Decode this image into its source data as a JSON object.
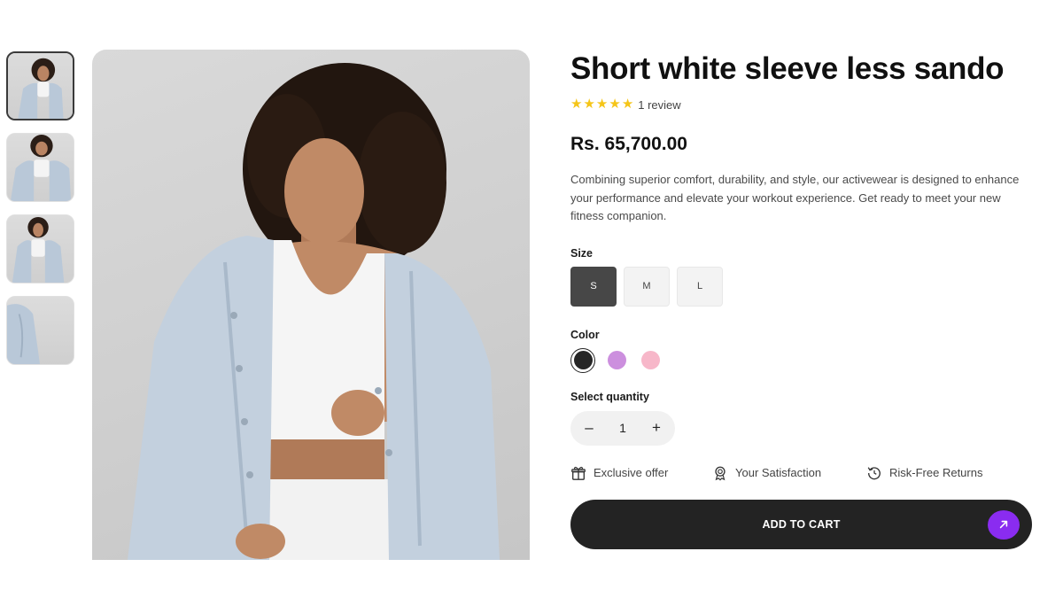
{
  "product": {
    "title": "Short white sleeve less sando",
    "rating": {
      "stars": 5,
      "max": 5,
      "review_text": "1 review"
    },
    "price": "Rs. 65,700.00",
    "description": "Combining superior comfort, durability, and style, our activewear is designed to enhance your performance and elevate your workout experience. Get ready to meet your new fitness companion."
  },
  "gallery": {
    "thumbnails": [
      "thumb-1",
      "thumb-2",
      "thumb-3",
      "thumb-4"
    ],
    "active_index": 0
  },
  "size": {
    "label": "Size",
    "options": [
      "S",
      "M",
      "L"
    ],
    "selected": "S"
  },
  "color": {
    "label": "Color",
    "options": [
      "#262626",
      "#cc8fde",
      "#f7b7c9"
    ],
    "selected_index": 0
  },
  "quantity": {
    "label": "Select quantity",
    "value": "1",
    "decrement": "–",
    "increment": "+"
  },
  "perks": [
    {
      "icon": "gift-icon",
      "label": "Exclusive offer"
    },
    {
      "icon": "award-icon",
      "label": "Your Satisfaction"
    },
    {
      "icon": "return-icon",
      "label": "Risk-Free Returns"
    }
  ],
  "cart": {
    "label": "ADD TO CART",
    "accent": "#8a2cf0",
    "icon": "arrow-up-right-icon"
  }
}
